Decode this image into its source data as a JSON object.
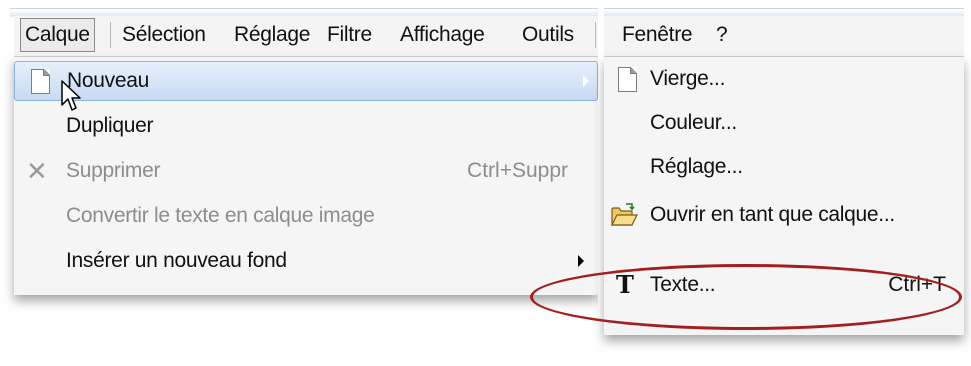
{
  "menubar": {
    "items": [
      "Calque",
      "Sélection",
      "Réglage",
      "Filtre",
      "Affichage",
      "Outils"
    ],
    "right_items": [
      "Fenêtre",
      "?"
    ]
  },
  "layer_menu": {
    "items": [
      {
        "label": "Nouveau",
        "icon": "document-icon",
        "submenu": true,
        "highlighted": true
      },
      {
        "label": "Dupliquer"
      },
      {
        "label": "Supprimer",
        "icon": "delete-x-icon",
        "shortcut": "Ctrl+Suppr",
        "disabled": true
      },
      {
        "label": "Convertir le texte en calque image",
        "disabled": true
      },
      {
        "label": "Insérer un nouveau fond",
        "submenu": true
      }
    ]
  },
  "new_submenu": {
    "items": [
      {
        "label": "Vierge...",
        "icon": "document-icon"
      },
      {
        "label": "Couleur..."
      },
      {
        "label": "Réglage..."
      },
      {
        "label": "Ouvrir en tant que calque...",
        "icon": "open-folder-icon"
      },
      {
        "label": "Texte...",
        "icon": "text-t-icon",
        "shortcut": "Ctrl+T",
        "circled": true
      }
    ]
  },
  "colors": {
    "highlight": "#c7dbf4",
    "annotation": "#a31e1e",
    "disabled_text": "#8d8d8d"
  }
}
